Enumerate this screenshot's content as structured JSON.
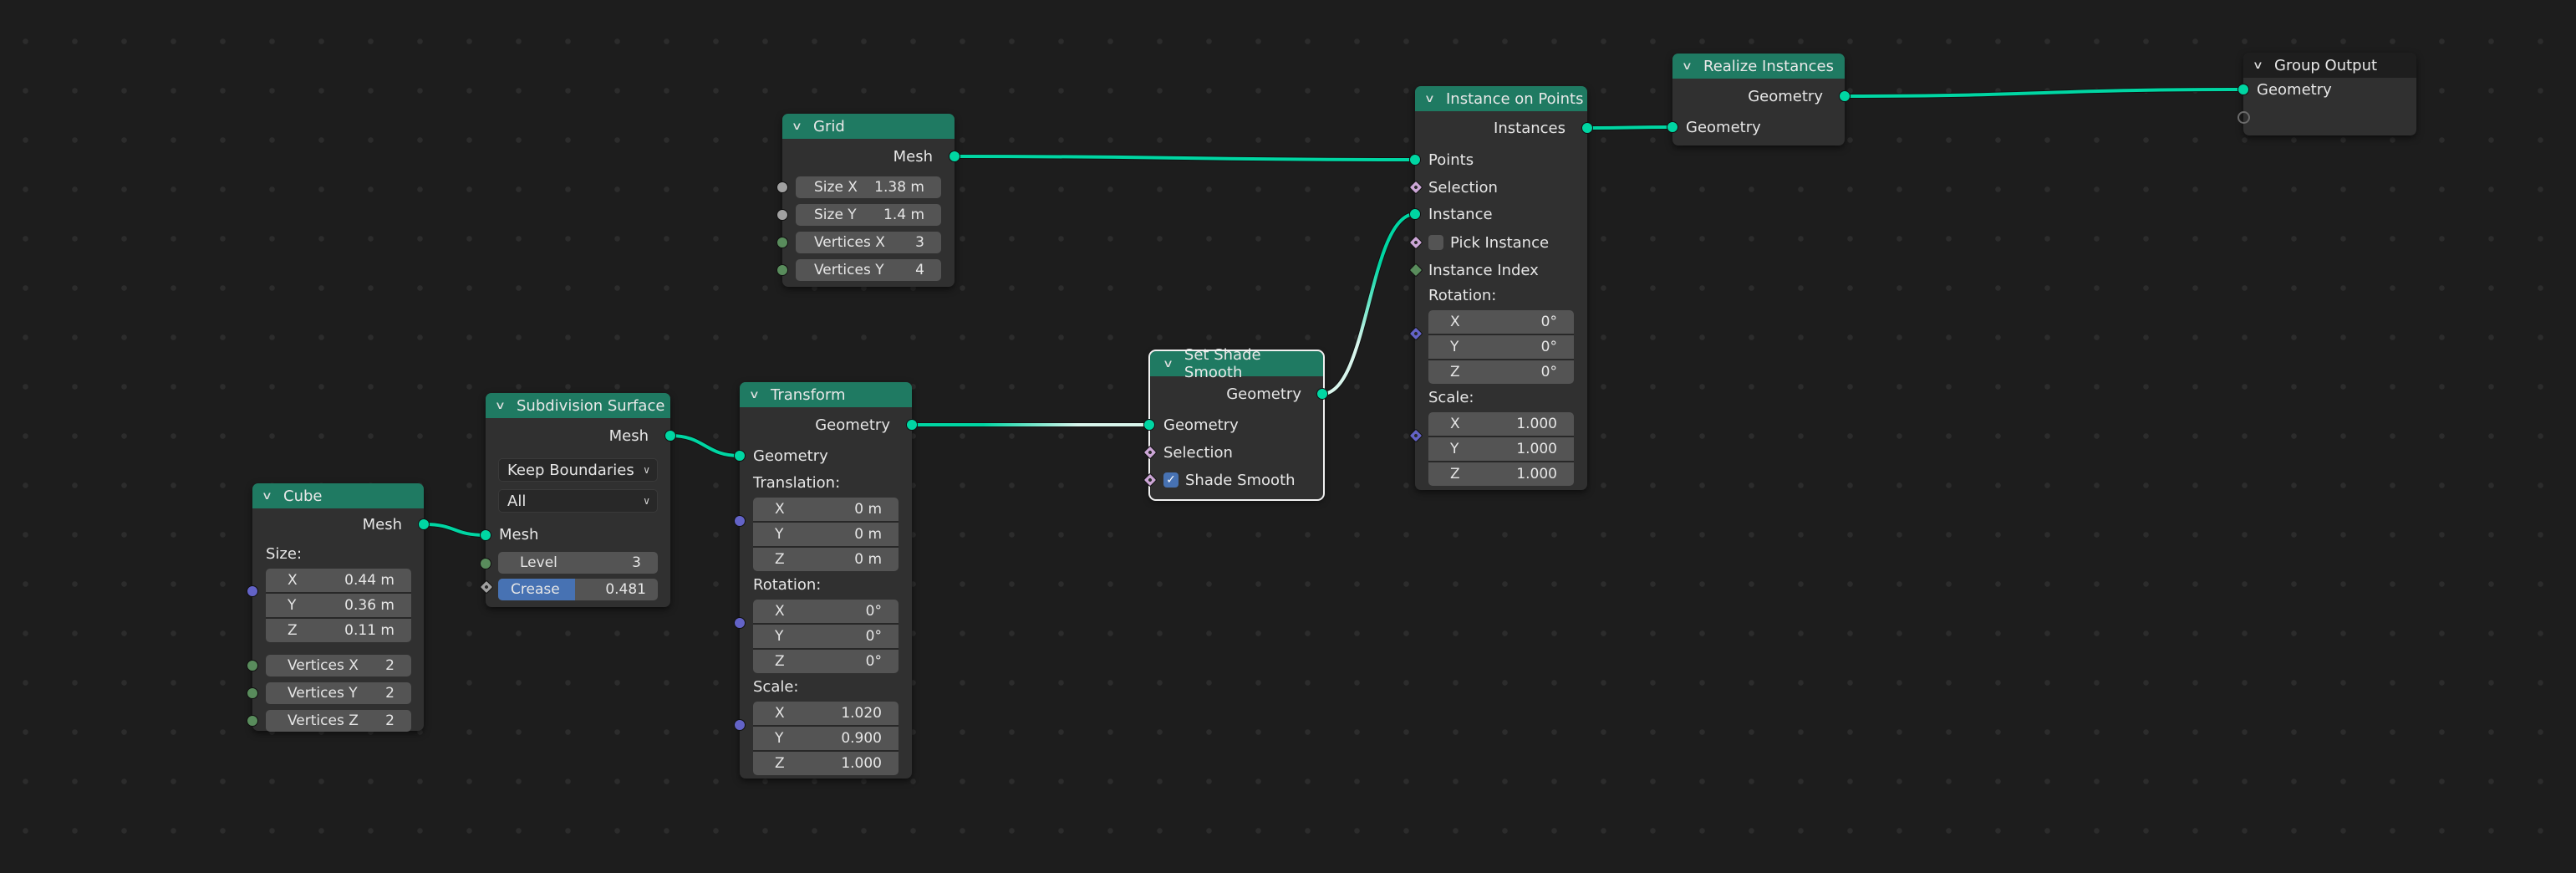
{
  "editor": "Geometry Node Editor",
  "colors": {
    "background": "#1d1d1d",
    "node_body": "#303030",
    "geometry_header": "#1f7a62",
    "output_header": "#1e1e1e",
    "geometry_socket": "#00d6a3",
    "vector_socket": "#6363c7",
    "integer_socket": "#598c5c",
    "float_socket": "#a1a1a1",
    "boolean_socket": "#cca6d6",
    "field_fill": "#4772b3",
    "selected_outline": "#f0f0f0"
  },
  "icons": {
    "collapse": "chevron-down-icon",
    "dropdown": "chevron-down-icon",
    "checkmark": "checkmark-icon"
  },
  "nodes": {
    "cube": {
      "title": "Cube",
      "output": "Mesh",
      "size_label": "Size:",
      "size": [
        {
          "axis": "X",
          "value": "0.44 m"
        },
        {
          "axis": "Y",
          "value": "0.36 m"
        },
        {
          "axis": "Z",
          "value": "0.11 m"
        }
      ],
      "vertices": [
        {
          "label": "Vertices X",
          "value": "2"
        },
        {
          "label": "Vertices Y",
          "value": "2"
        },
        {
          "label": "Vertices Z",
          "value": "2"
        }
      ]
    },
    "subdivision": {
      "title": "Subdivision Surface",
      "output": "Mesh",
      "boundary_mode": "Keep Boundaries",
      "uv_smooth": "All",
      "input": "Mesh",
      "level": {
        "label": "Level",
        "value": "3"
      },
      "crease": {
        "label": "Crease",
        "value": "0.481",
        "fraction": 0.481
      }
    },
    "grid": {
      "title": "Grid",
      "output": "Mesh",
      "fields": [
        {
          "label": "Size X",
          "value": "1.38 m"
        },
        {
          "label": "Size Y",
          "value": "1.4 m"
        },
        {
          "label": "Vertices X",
          "value": "3"
        },
        {
          "label": "Vertices Y",
          "value": "4"
        }
      ]
    },
    "transform": {
      "title": "Transform",
      "output": "Geometry",
      "input": "Geometry",
      "translation_label": "Translation:",
      "translation": [
        {
          "axis": "X",
          "value": "0 m"
        },
        {
          "axis": "Y",
          "value": "0 m"
        },
        {
          "axis": "Z",
          "value": "0 m"
        }
      ],
      "rotation_label": "Rotation:",
      "rotation": [
        {
          "axis": "X",
          "value": "0°"
        },
        {
          "axis": "Y",
          "value": "0°"
        },
        {
          "axis": "Z",
          "value": "0°"
        }
      ],
      "scale_label": "Scale:",
      "scale": [
        {
          "axis": "X",
          "value": "1.020"
        },
        {
          "axis": "Y",
          "value": "0.900"
        },
        {
          "axis": "Z",
          "value": "1.000"
        }
      ]
    },
    "shade_smooth": {
      "title": "Set Shade Smooth",
      "selected": true,
      "output": "Geometry",
      "input_geometry": "Geometry",
      "input_selection": "Selection",
      "shade_smooth_label": "Shade Smooth",
      "shade_smooth_checked": true
    },
    "instance_on_points": {
      "title": "Instance on Points",
      "output": "Instances",
      "points": "Points",
      "selection": "Selection",
      "instance": "Instance",
      "pick_instance_label": "Pick Instance",
      "pick_instance_checked": false,
      "instance_index": "Instance Index",
      "rotation_label": "Rotation:",
      "rotation": [
        {
          "axis": "X",
          "value": "0°"
        },
        {
          "axis": "Y",
          "value": "0°"
        },
        {
          "axis": "Z",
          "value": "0°"
        }
      ],
      "scale_label": "Scale:",
      "scale": [
        {
          "axis": "X",
          "value": "1.000"
        },
        {
          "axis": "Y",
          "value": "1.000"
        },
        {
          "axis": "Z",
          "value": "1.000"
        }
      ]
    },
    "realize": {
      "title": "Realize Instances",
      "output": "Geometry",
      "input": "Geometry"
    },
    "group_output": {
      "title": "Group Output",
      "input": "Geometry"
    }
  },
  "links": [
    {
      "from": "cube.Mesh",
      "to": "subdivision.Mesh"
    },
    {
      "from": "subdivision.Mesh",
      "to": "transform.Geometry"
    },
    {
      "from": "transform.Geometry",
      "to": "shade_smooth.Geometry"
    },
    {
      "from": "shade_smooth.Geometry",
      "to": "instance_on_points.Instance"
    },
    {
      "from": "grid.Mesh",
      "to": "instance_on_points.Points"
    },
    {
      "from": "instance_on_points.Instances",
      "to": "realize.Geometry"
    },
    {
      "from": "realize.Geometry",
      "to": "group_output.Geometry"
    }
  ]
}
